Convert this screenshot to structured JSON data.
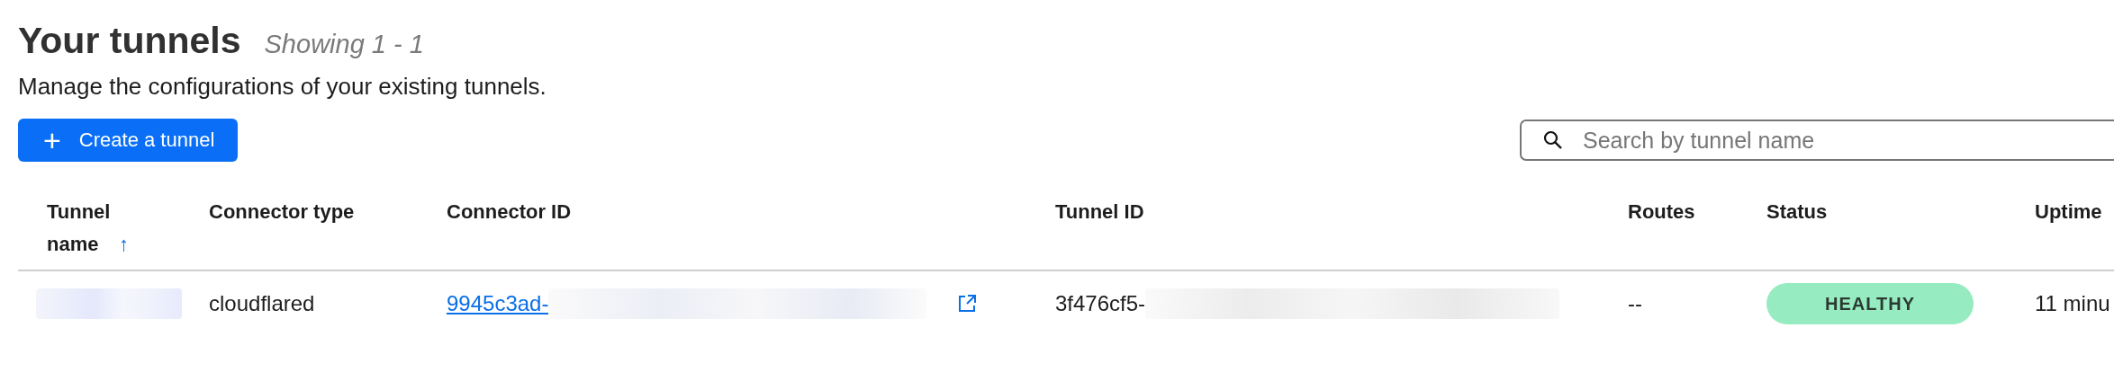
{
  "header": {
    "title": "Your tunnels",
    "count": "Showing 1 - 1",
    "description": "Manage the configurations of your existing tunnels."
  },
  "create_button": {
    "label": "Create a tunnel",
    "icon": "+"
  },
  "search": {
    "placeholder": "Search by tunnel name"
  },
  "table": {
    "columns": [
      {
        "label": "Tunnel name",
        "sort": "↑"
      },
      {
        "label": "Connector type"
      },
      {
        "label": "Connector ID"
      },
      {
        "label": "Tunnel ID"
      },
      {
        "label": "Routes"
      },
      {
        "label": "Status"
      },
      {
        "label": "Uptime"
      }
    ],
    "rows": [
      {
        "connector_type": "cloudflared",
        "connector_id": "9945c3ad-",
        "tunnel_id": "3f476cf5-",
        "routes": "--",
        "status": "HEALTHY",
        "color": "#96ecc0",
        "uptime": "11 minu"
      }
    ]
  }
}
